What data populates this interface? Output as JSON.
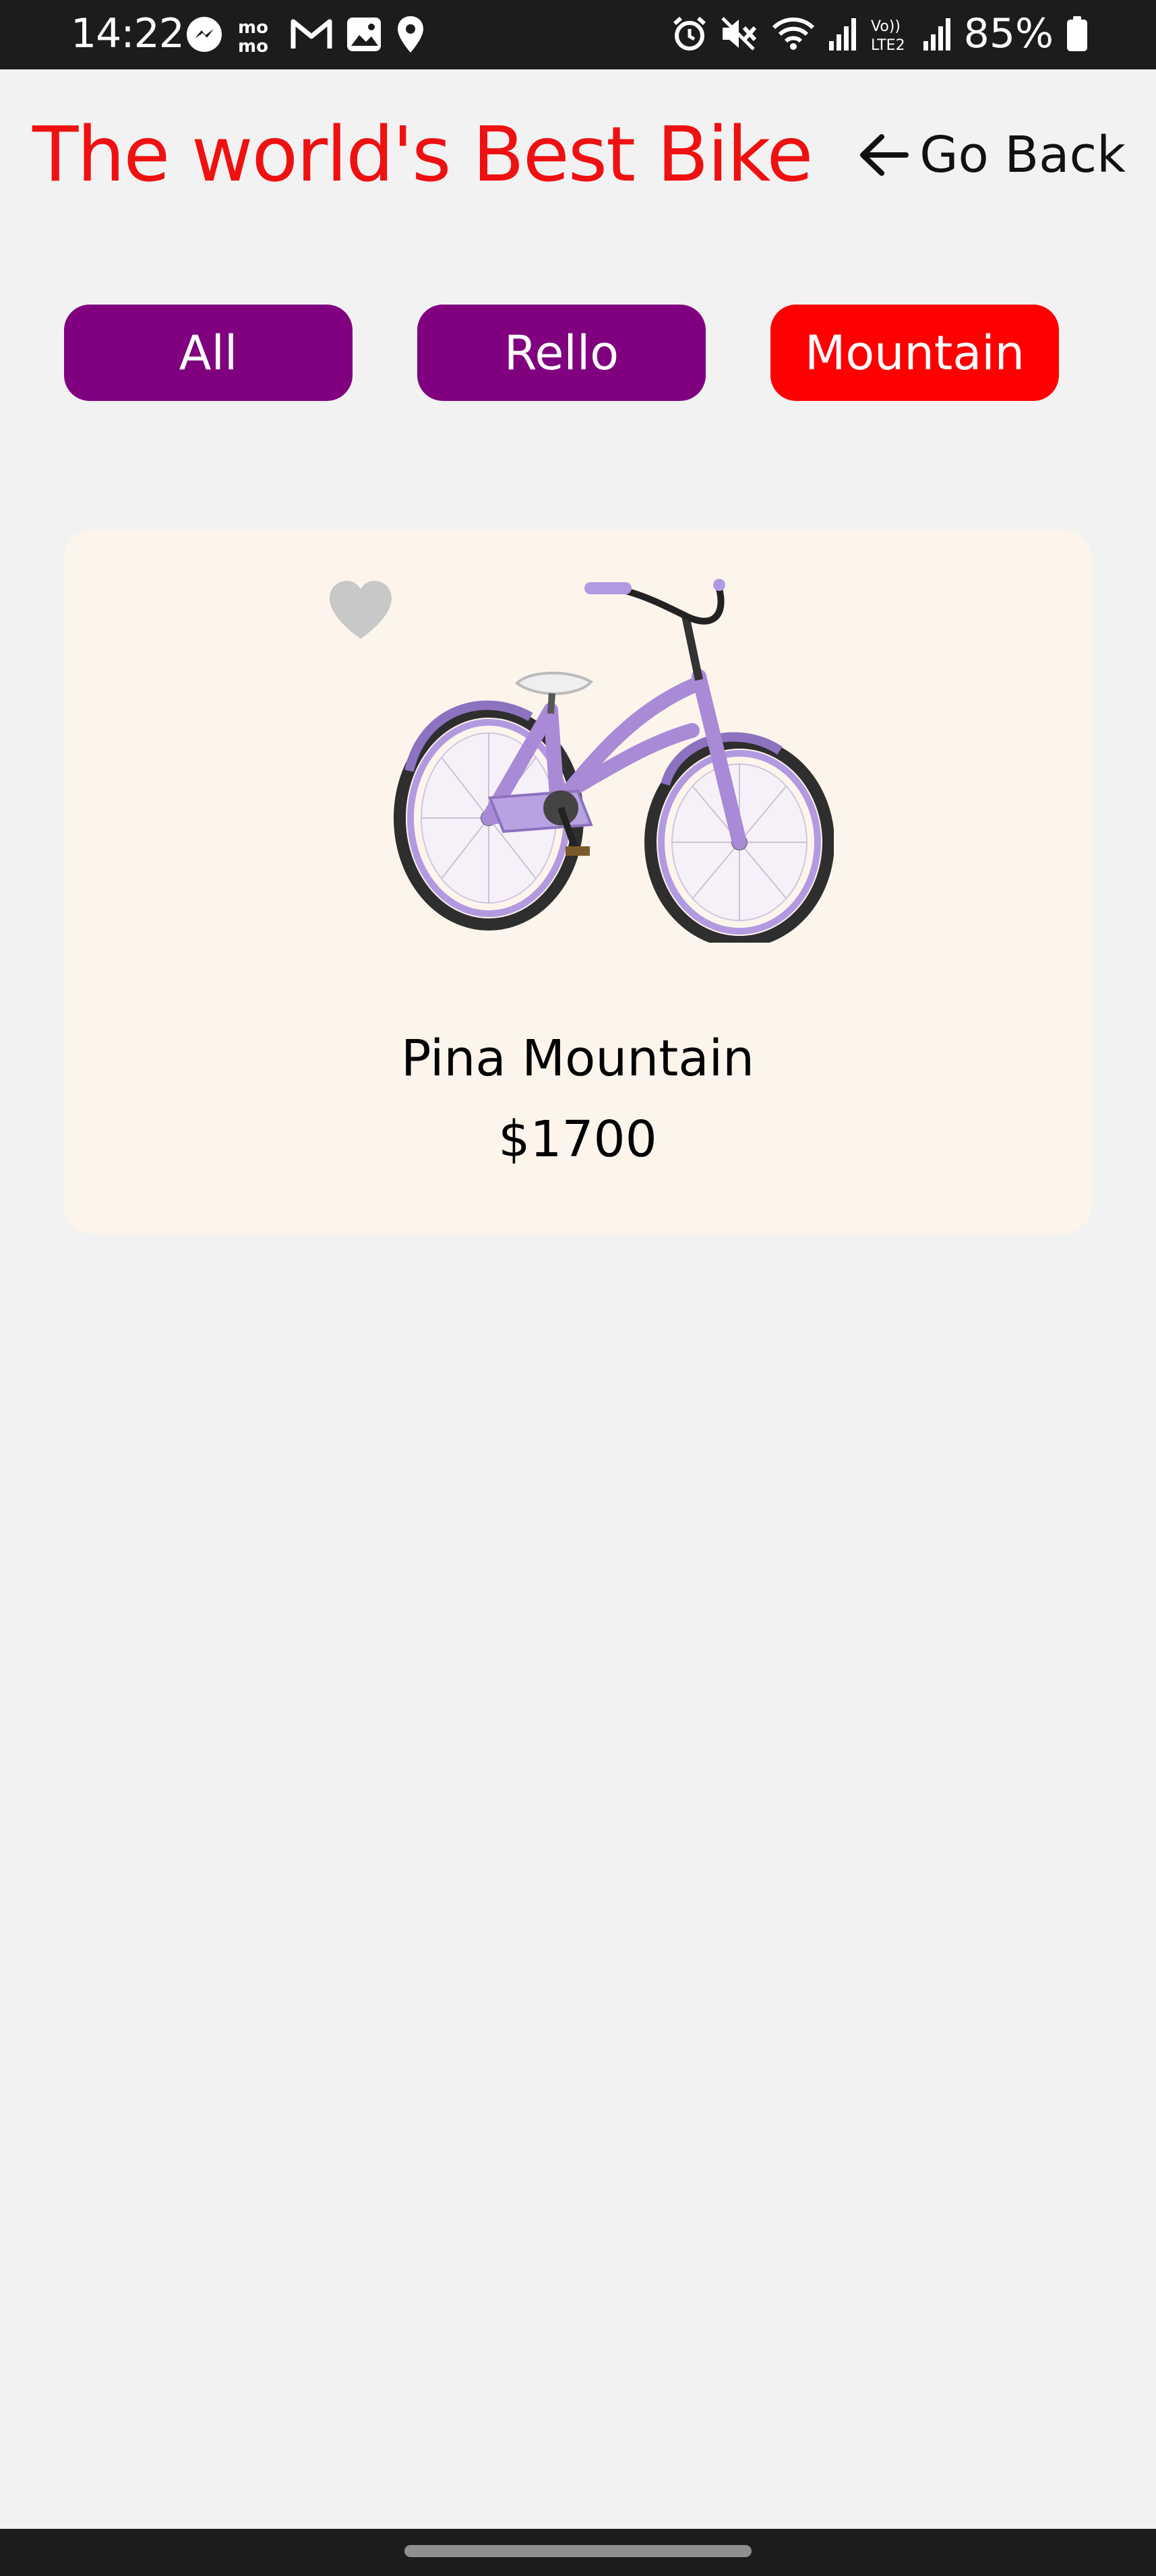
{
  "status_bar": {
    "time": "14:22",
    "battery": "85%",
    "left_icons": [
      "messenger-icon",
      "momo-icon",
      "gmail-icon",
      "gallery-icon",
      "location-icon"
    ],
    "right_icons": [
      "alarm-icon",
      "mute-icon",
      "wifi-icon",
      "signal-icon",
      "volte-icon",
      "signal-icon",
      "battery-icon"
    ]
  },
  "header": {
    "title": "The world's Best Bike",
    "back_label": "Go Back",
    "title_color": "#ee1111"
  },
  "filters": {
    "items": [
      {
        "label": "All",
        "active": false
      },
      {
        "label": "Rello",
        "active": false
      },
      {
        "label": "Mountain",
        "active": true
      }
    ],
    "inactive_color": "#800080",
    "active_color": "#ff0000"
  },
  "products": [
    {
      "name": "Pina Mountain",
      "price": "$1700",
      "favorite": false,
      "image": "purple-cruiser-bike"
    }
  ],
  "colors": {
    "background": "#f2f2f2",
    "card": "#fdf5ec",
    "system_bar": "#1b1c1e",
    "bike_frame": "#a98ad6"
  }
}
